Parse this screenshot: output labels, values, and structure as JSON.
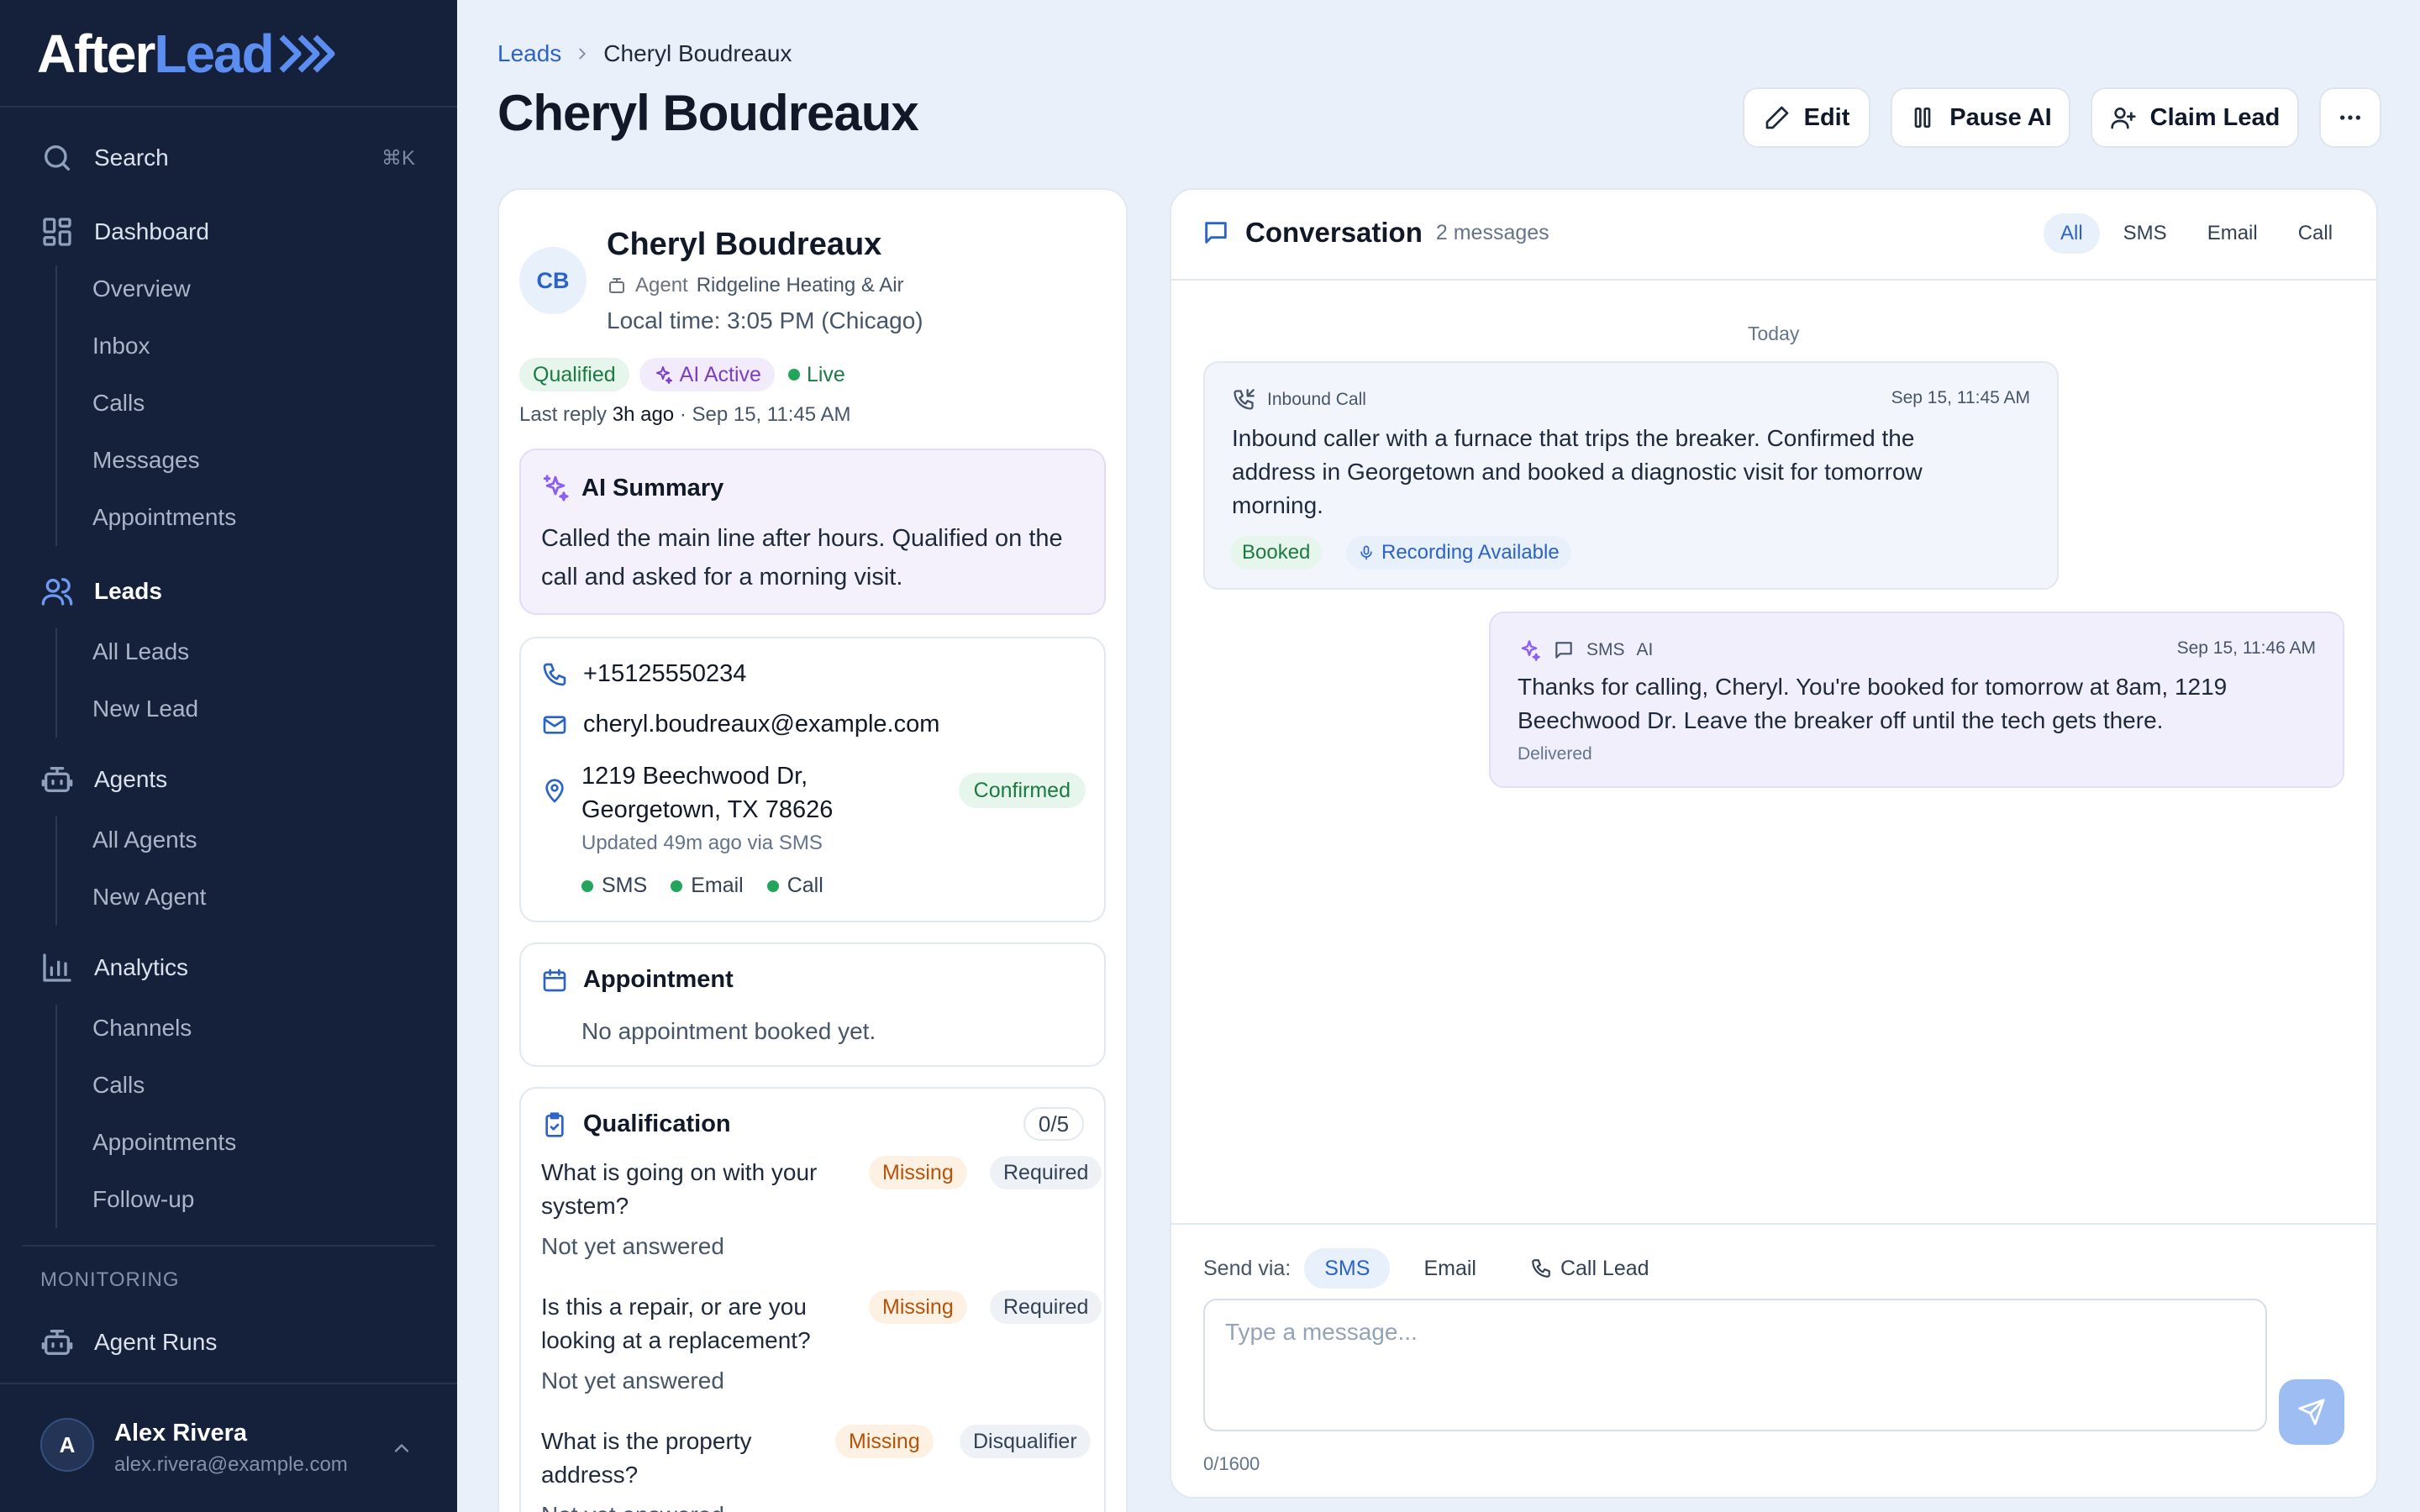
{
  "app": {
    "logo_a": "After",
    "logo_b": "Lead"
  },
  "sidebar": {
    "search_label": "Search",
    "search_shortcut": "⌘K",
    "dashboard": {
      "label": "Dashboard",
      "items": [
        "Overview",
        "Inbox",
        "Calls",
        "Messages",
        "Appointments"
      ]
    },
    "leads": {
      "label": "Leads",
      "items": [
        "All Leads",
        "New Lead"
      ]
    },
    "agents": {
      "label": "Agents",
      "items": [
        "All Agents",
        "New Agent"
      ]
    },
    "analytics": {
      "label": "Analytics",
      "items": [
        "Channels",
        "Calls",
        "Appointments",
        "Follow-up"
      ]
    },
    "monitoring_label": "MONITORING",
    "agent_runs": "Agent Runs",
    "user": {
      "initial": "A",
      "name": "Alex Rivera",
      "email": "alex.rivera@example.com"
    }
  },
  "header": {
    "breadcrumb_parent": "Leads",
    "breadcrumb_current": "Cheryl Boudreaux",
    "title": "Cheryl Boudreaux",
    "edit": "Edit",
    "pause_ai": "Pause AI",
    "claim_lead": "Claim Lead"
  },
  "lead": {
    "initials": "CB",
    "name": "Cheryl Boudreaux",
    "agent_prefix": "Agent",
    "agent_name": "Ridgeline Heating & Air",
    "local_time": "Local time: 3:05 PM (Chicago)",
    "badges": {
      "qualified": "Qualified",
      "ai_active": "AI Active",
      "live": "Live"
    },
    "last_reply_prefix": "Last reply",
    "last_reply_ago": "3h ago",
    "last_reply_when": "· Sep 15, 11:45 AM",
    "ai_summary_title": "AI Summary",
    "ai_summary": "Called the main line after hours. Qualified on the call and asked for a morning visit.",
    "phone": "+15125550234",
    "email": "cheryl.boudreaux@example.com",
    "address_line1": "1219 Beechwood Dr,",
    "address_line2": "Georgetown, TX 78626",
    "address_status": "Confirmed",
    "address_updated": "Updated 49m ago via SMS",
    "channels": [
      "SMS",
      "Email",
      "Call"
    ],
    "appointment_title": "Appointment",
    "appointment_text": "No appointment booked yet.",
    "qualification_title": "Qualification",
    "qualification_count": "0/5",
    "questions": [
      {
        "q": "What is going on with your system?",
        "status": "Missing",
        "type": "Required",
        "answer": "Not yet answered"
      },
      {
        "q": "Is this a repair, or are you looking at a replacement?",
        "status": "Missing",
        "type": "Required",
        "answer": "Not yet answered"
      },
      {
        "q": "What is the property address?",
        "status": "Missing",
        "type": "Disqualifier",
        "answer": "Not yet answered"
      }
    ]
  },
  "conversation": {
    "title": "Conversation",
    "count": "2 messages",
    "filters": [
      "All",
      "SMS",
      "Email",
      "Call"
    ],
    "day": "Today",
    "messages": [
      {
        "kind": "Inbound Call",
        "time": "Sep 15, 11:45 AM",
        "line1": "Inbound caller with a furnace that trips the breaker. Confirmed the",
        "line2": "address in Georgetown and booked a diagnostic visit for tomorrow",
        "line3": "morning.",
        "tag1": "Booked",
        "tag2": "Recording Available"
      },
      {
        "channel": "SMS",
        "sender": "AI",
        "time": "Sep 15, 11:46 AM",
        "line1": "Thanks for calling, Cheryl. You're booked for tomorrow at 8am, 1219",
        "line2": "Beechwood Dr. Leave the breaker off until the tech gets there.",
        "status": "Delivered"
      }
    ],
    "send_via_label": "Send via:",
    "send_options": [
      "SMS",
      "Email",
      "Call Lead"
    ],
    "placeholder": "Type a message...",
    "char_count": "0/1600"
  }
}
